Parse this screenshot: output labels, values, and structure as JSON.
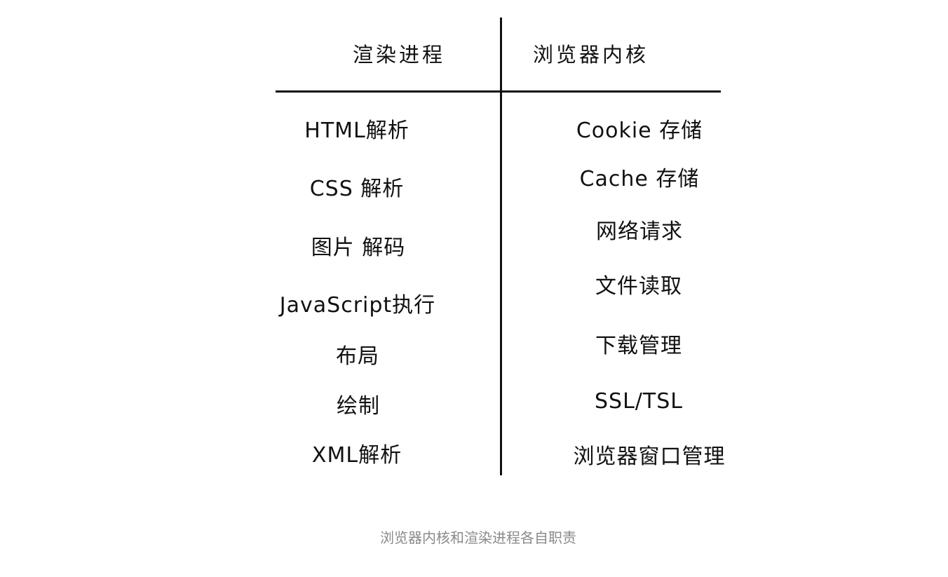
{
  "table": {
    "left_header": "渲染进程",
    "right_header": "浏览器内核",
    "left_items": [
      "HTML解析",
      "CSS 解析",
      "图片 解码",
      "JavaScript执行",
      "布局",
      "绘制",
      "XML解析"
    ],
    "right_items": [
      "Cookie 存储",
      "Cache 存储",
      "网络请求",
      "文件读取",
      "下载管理",
      "SSL/TSL",
      "浏览器窗口管理"
    ]
  },
  "caption": "浏览器内核和渲染进程各自职责",
  "colors": {
    "ink": "#111111",
    "caption": "#8a8a8a",
    "background": "#ffffff"
  }
}
